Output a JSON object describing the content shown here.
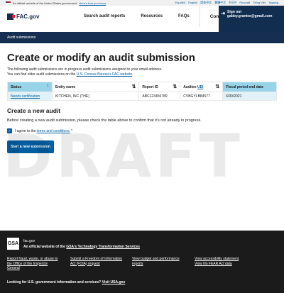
{
  "gov_banner": {
    "text": "An official website of the United States government",
    "how_link": "Here's how you know",
    "languages": [
      "Español",
      "English",
      "简体中文",
      "繁體中文",
      "한국어",
      "Русский",
      "Tiếng Việt",
      "Tagalog"
    ]
  },
  "header": {
    "logo_text": "FAC.gov",
    "nav": [
      "Search audit reports",
      "Resources",
      "FAQs"
    ],
    "contact": "Contact us",
    "signout_label": "Sign out",
    "user_email": "gabby.grantee@gmail.com"
  },
  "subbar": {
    "label": "Audit submissions"
  },
  "main": {
    "title": "Create or modify an audit submission",
    "intro_line1": "The following audit submissions are in progress audit submissions assigned to your email address.",
    "intro_line2_prefix": "You can find older audit submissions on the ",
    "intro_link": "U.S. Census Bureau's FAC website",
    "intro_line2_suffix": "."
  },
  "table": {
    "headers": [
      "Status",
      "Entity name",
      "Report ID",
      "Auditee UEI",
      "Fiscal period end date"
    ],
    "uei_abbr": "UEI",
    "auditee_prefix": "Auditee ",
    "rows": [
      [
        "Needs certification",
        "KITCHEN, INC (THE)",
        "ABC123456789",
        "CVBGYLB84577",
        "6/30/2021"
      ]
    ]
  },
  "new_audit": {
    "title": "Create a new audit",
    "description": "Before creating a new audit submission, please check the table above to confirm that it's not already in progress.",
    "checkbox_prefix": "I agree to the ",
    "terms_link": "terms and conditions.",
    "required_mark": "*",
    "start_button": "Start a new submission"
  },
  "watermark": "DRAFT",
  "footer": {
    "logo": "GSA",
    "domain": "fac.gov",
    "official_prefix": "An official website of the ",
    "official_link": "GSA's Technology Transformation Services",
    "col1": [
      "Report fraud, waste, or abuse to",
      "the Office of the Inspector",
      "General"
    ],
    "col2": [
      "Submit a Freedom of Information",
      "Act (FOIA) request"
    ],
    "col3": [
      "View budget and performance",
      "reports"
    ],
    "col4": [
      "View accessibility statement",
      "View No FEAR Act data"
    ],
    "looking_prefix": "Looking for U.S. government information and services? ",
    "looking_link": "Visit USA.gov"
  },
  "colors": {
    "navy": "#162e51",
    "primary": "#005ea2",
    "sorted_header": "#97d4ea",
    "sorted_cell": "#e1f3f8",
    "footer_bg": "#1b1b1b"
  }
}
